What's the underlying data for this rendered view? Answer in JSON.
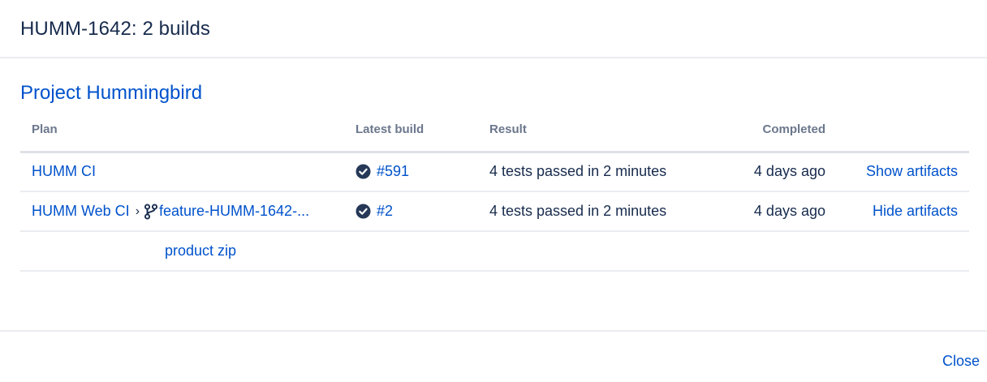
{
  "dialog": {
    "title": "HUMM-1642: 2 builds",
    "close_label": "Close"
  },
  "project": {
    "name": "Project Hummingbird"
  },
  "table": {
    "headers": {
      "plan": "Plan",
      "latest_build": "Latest build",
      "result": "Result",
      "completed": "Completed"
    },
    "rows": [
      {
        "plan": "HUMM CI",
        "branch": "",
        "build": "#591",
        "status": "success",
        "result": "4 tests passed in 2 minutes",
        "completed": "4 days ago",
        "action": "Show artifacts"
      },
      {
        "plan": "HUMM Web CI",
        "separator": "›",
        "branch": "feature-HUMM-1642-...",
        "build": "#2",
        "status": "success",
        "result": "4 tests passed in 2 minutes",
        "completed": "4 days ago",
        "action": "Hide artifacts"
      }
    ],
    "artifacts": [
      {
        "label": "product zip"
      }
    ]
  },
  "icons": {
    "status": "check-circle-icon",
    "branch": "branch-icon"
  },
  "colors": {
    "link": "#0052cc",
    "text": "#172b4d",
    "header_text": "#6b778c",
    "divider": "#ebecf0",
    "status_success": "#253858"
  }
}
